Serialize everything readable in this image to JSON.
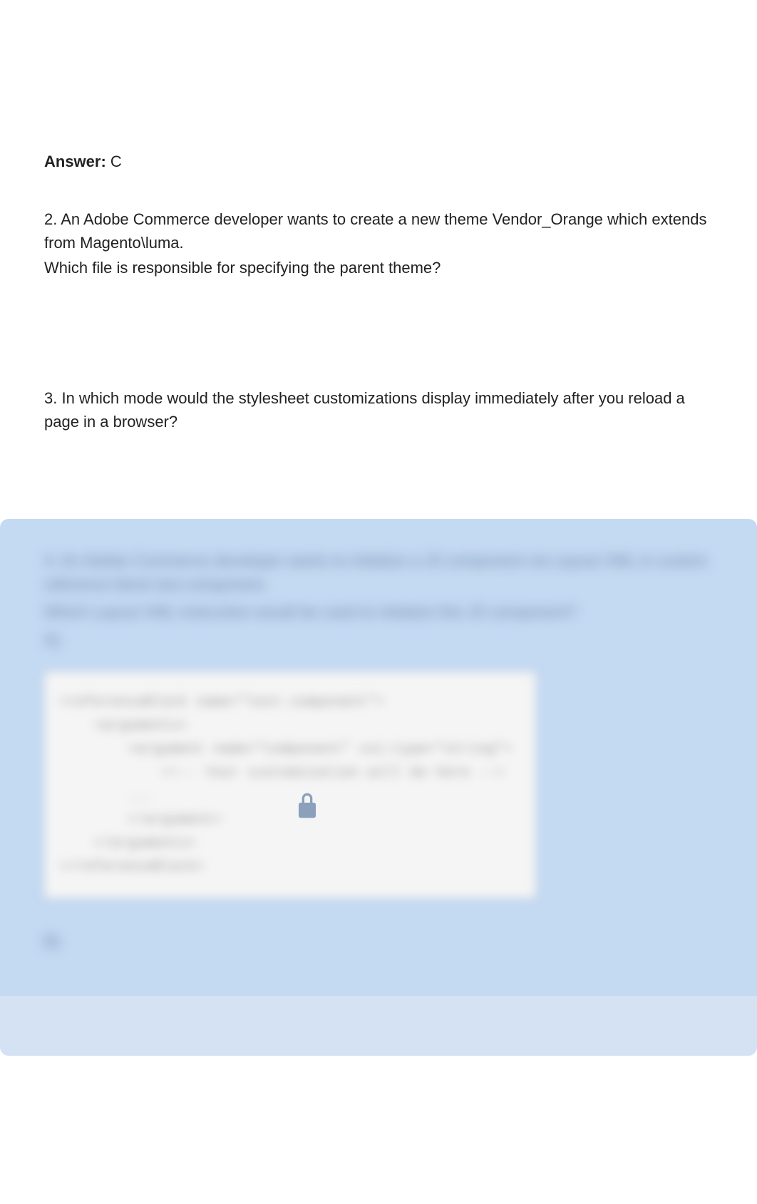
{
  "answer": {
    "label": "Answer:",
    "value": " C"
  },
  "q2": {
    "line1": "2. An Adobe Commerce developer wants to create a new theme Vendor_Orange which extends from Magento\\luma.",
    "line2": "Which file is responsible for specifying the parent theme?"
  },
  "q3": {
    "line1": "3. In which mode would the stylesheet customizations display immediately after you reload a page in a browser?"
  },
  "blurred": {
    "line1": "4. An Adobe Commerce developer wants to initialize a JS component via Layout XML in custom reference block test.component.",
    "line2": "Which Layout XML instruction would be used to initialize this JS component?",
    "optA": "A)",
    "code1": "<referenceBlock name=\"test.component\">",
    "code2": "    <arguments>",
    "code3": "        <argument name=\"component\" xsi:type=\"string\">",
    "code4": "            <!-- Your customization will be here -->",
    "code5": "        ...",
    "code6": "        </argument>",
    "code7": "    </arguments>",
    "code8": "</referenceBlock>",
    "optB": "B)"
  }
}
